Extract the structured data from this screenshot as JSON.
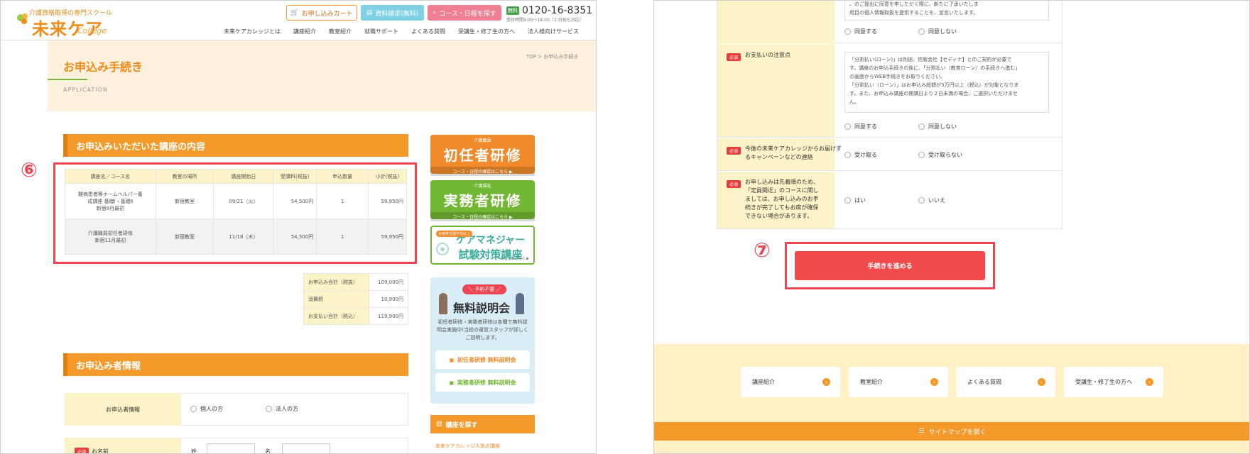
{
  "header": {
    "tagline": "介護資格取得の専門スクール",
    "logo_main": "未来ケア",
    "logo_sub": "College",
    "btn_apply_cart": "お申し込みカート",
    "btn_brochure": "資料請求(無料)",
    "btn_course_search": "コース・日程を探す",
    "free_badge": "無料",
    "phone": "0120-16-8351",
    "hours": "受付時間9:00～18:00（土日祝も対応）",
    "nav": [
      "未来ケアカレッジとは",
      "講座紹介",
      "教室紹介",
      "就職サポート",
      "よくある質問",
      "受講生・修了生の方へ",
      "法人様向けサービス"
    ]
  },
  "page": {
    "title": "お申込み手続き",
    "subtitle": "APPLICATION",
    "breadcrumb": "TOP > お申込み手続き"
  },
  "courses_section": {
    "heading": "お申込みいただいた講座の内容",
    "marker": "⑥",
    "columns": [
      "講座名／コース名",
      "教室の場所",
      "講座開始日",
      "受講料(税抜)",
      "申込数量",
      "小計(税抜)"
    ],
    "rows": [
      {
        "name_l1": "難病患者等ホームヘルパー養",
        "name_l2": "成講座 基礎Ⅰ・基礎Ⅱ",
        "name_l3": "新宿9月最初",
        "place": "新宿教室",
        "start": "09/21（火）",
        "fee": "54,500円",
        "qty": "1",
        "subtotal": "59,950円"
      },
      {
        "name_l1": "介護職員初任者研修",
        "name_l2": "新宿11月最初",
        "name_l3": "",
        "place": "新宿教室",
        "start": "11/18（木）",
        "fee": "54,500円",
        "qty": "1",
        "subtotal": "59,950円"
      }
    ],
    "totals": [
      {
        "label": "お申込み合計（税抜）",
        "value": "109,000円"
      },
      {
        "label": "消費税",
        "value": "10,900円"
      },
      {
        "label": "お支払い合計（税込）",
        "value": "119,900円"
      }
    ]
  },
  "applicant_section": {
    "heading": "お申込み者情報",
    "type_label": "お申込者情報",
    "opt_individual": "個人の方",
    "opt_corporate": "法人の方",
    "name_req": "必須",
    "name_label": "お名前",
    "last_label": "姓",
    "first_label": "名"
  },
  "sidebar": {
    "banner1_top": "介護職員",
    "banner1_main": "初任者研修",
    "banner1_bottom": "コース・日程の確認はこちら ▶",
    "banner2_top": "介護福祉",
    "banner2_main": "実務者研修",
    "banner2_bottom": "コース・日程の確認はこちら ▶",
    "banner3_tag": "合格率全国平均以上",
    "banner3_l1": "ケアマネジャー",
    "banner3_l2": "試験対策講座",
    "banner3_more": "詳しくはこちら ▶",
    "seminar_tag": "＼ 予約不要 ／",
    "seminar_title": "無料説明会",
    "seminar_desc": "初任者研修・実務者研修は各種で無料説明会実施中!当校の運営スタッフが詳しくご説明します。",
    "seminar_btn1": "初任者研修 無料説明会",
    "seminar_btn2": "実務者研修 無料説明会",
    "find_heading": "講座を探す",
    "find_link": "未来ケアカレッジ人気の講座"
  },
  "agreements": {
    "top_text_1": "、のご提出に同意を申しただく際に、新たに了承いたしま",
    "top_text_2": "用目の個人情報取扱を提供することを、宣言いたします。",
    "agree": "同意する",
    "disagree": "同意しない",
    "req": "必須",
    "payment_label": "お支払いの注意点",
    "payment_text": [
      "「分割払い(ローン)」は別途、信販会社【セディナ】とのご契約が必要で",
      "す。講座のお申込手続きの後に、「分割払い（教育ローン）の手続きへ進む」",
      "の画面からWEB手続きをお取りください。",
      "「分割払い（ローン）」はお申込み総額が3万円以上（税込）が対象となりま",
      "す。また、お申込み講座の開講日より２日未満の場合、ご選択いただけませ",
      "ん。"
    ],
    "campaign_label_1": "今後の未来ケアカレッジからお届けす",
    "campaign_label_2": "るキャンペーンなどの連絡",
    "receive": "受け取る",
    "not_receive": "受け取らない",
    "first_come_1": "お申し込みは先着順のため、",
    "first_come_2": "「定員間近」のコースに関し",
    "first_come_3": "ましては、お申し込みのお手",
    "first_come_4": "続きが完了してもお席が確保",
    "first_come_5": "できない場合があります。",
    "yes": "はい",
    "no": "いいえ"
  },
  "submit": {
    "marker": "⑦",
    "label": "手続きを進める"
  },
  "footer": {
    "nav": [
      "講座紹介",
      "教室紹介",
      "よくある質問",
      "受講生・修了生の方へ"
    ],
    "sitemap": "サイトマップを開く"
  },
  "colors": {
    "accent_orange": "#f39a2b",
    "accent_green": "#72b733",
    "highlight_red": "#ec4652",
    "submit_red": "#f14a4a"
  }
}
